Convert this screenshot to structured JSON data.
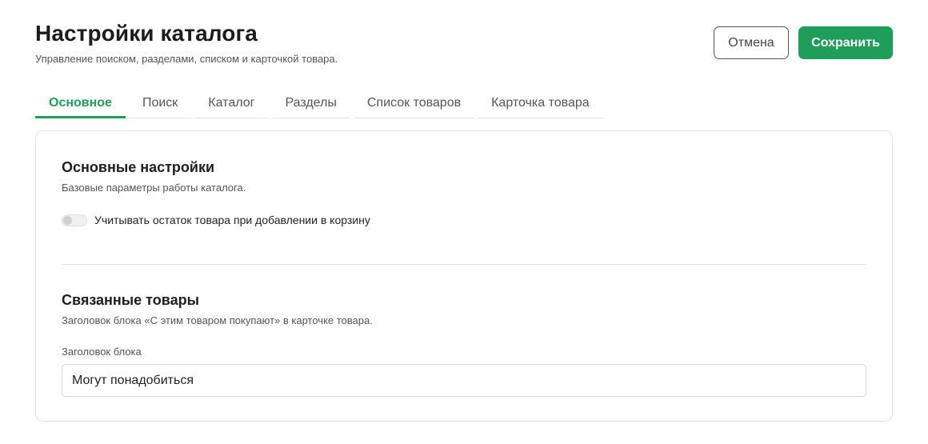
{
  "header": {
    "title": "Настройки каталога",
    "subtitle": "Управление поиском, разделами, списком и карточкой товара."
  },
  "actions": {
    "cancel_label": "Отмена",
    "save_label": "Сохранить"
  },
  "tabs": [
    {
      "label": "Основное",
      "active": true
    },
    {
      "label": "Поиск",
      "active": false
    },
    {
      "label": "Каталог",
      "active": false
    },
    {
      "label": "Разделы",
      "active": false
    },
    {
      "label": "Список товаров",
      "active": false
    },
    {
      "label": "Карточка товара",
      "active": false
    }
  ],
  "sections": {
    "main": {
      "title": "Основные настройки",
      "description": "Базовые параметры работы каталога.",
      "toggle_label": "Учитывать остаток товара при добавлении в корзину",
      "toggle_on": false
    },
    "related": {
      "title": "Связанные товары",
      "description": "Заголовок блока «С этим товаром покупают» в карточке товара.",
      "field_label": "Заголовок блока",
      "field_value": "Могут понадобиться"
    }
  },
  "colors": {
    "accent": "#1f9e5a"
  }
}
